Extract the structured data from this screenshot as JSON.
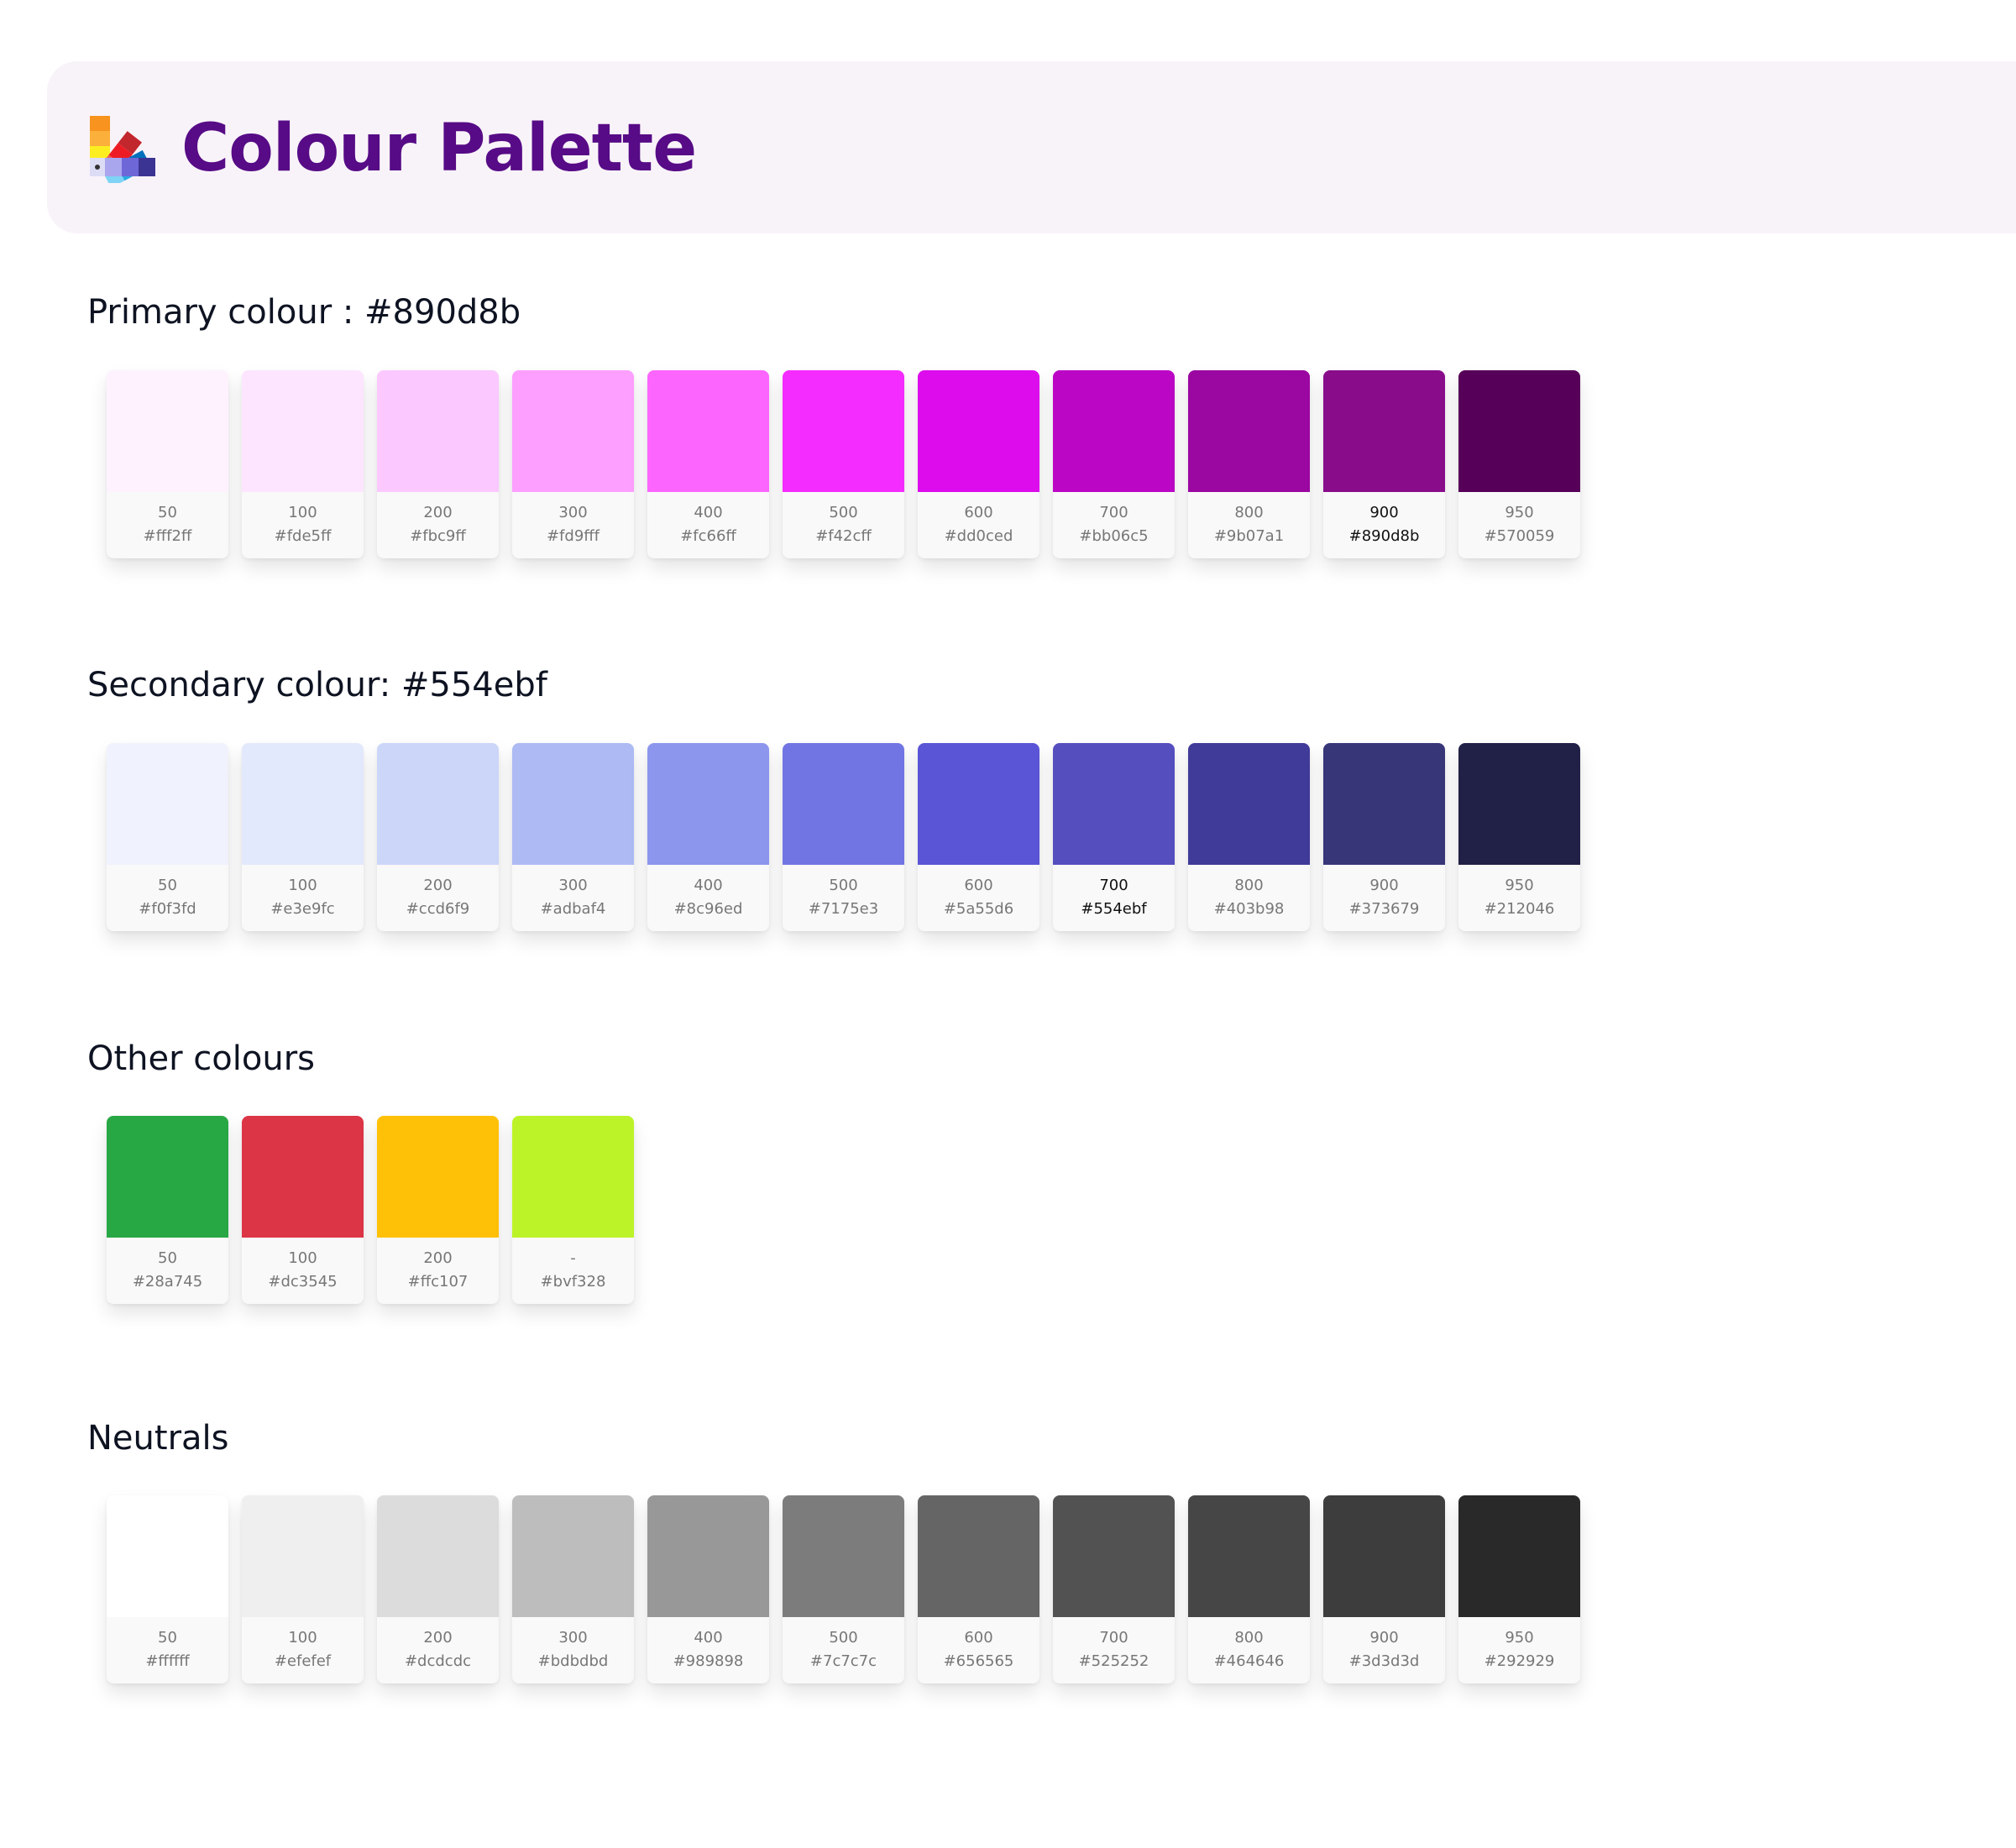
{
  "header": {
    "title": "Colour Palette",
    "icon": "colour-swatch-fan-icon"
  },
  "sections": [
    {
      "title": "Primary colour : #890d8b",
      "swatches": [
        {
          "name": "50",
          "hex": "#fff2ff",
          "color": "#fff2ff",
          "highlight": false
        },
        {
          "name": "100",
          "hex": "#fde5ff",
          "color": "#fde5ff",
          "highlight": false
        },
        {
          "name": "200",
          "hex": "#fbc9ff",
          "color": "#fbc9ff",
          "highlight": false
        },
        {
          "name": "300",
          "hex": "#fd9fff",
          "color": "#fd9fff",
          "highlight": false
        },
        {
          "name": "400",
          "hex": "#fc66ff",
          "color": "#fc66ff",
          "highlight": false
        },
        {
          "name": "500",
          "hex": "#f42cff",
          "color": "#f42cff",
          "highlight": false
        },
        {
          "name": "600",
          "hex": "#dd0ced",
          "color": "#dd0ced",
          "highlight": false
        },
        {
          "name": "700",
          "hex": "#bb06c5",
          "color": "#bb06c5",
          "highlight": false
        },
        {
          "name": "800",
          "hex": "#9b07a1",
          "color": "#9b07a1",
          "highlight": false
        },
        {
          "name": "900",
          "hex": "#890d8b",
          "color": "#890d8b",
          "highlight": true
        },
        {
          "name": "950",
          "hex": "#570059",
          "color": "#570059",
          "highlight": false
        }
      ]
    },
    {
      "title": "Secondary colour: #554ebf",
      "swatches": [
        {
          "name": "50",
          "hex": "#f0f3fd",
          "color": "#f0f3fd",
          "highlight": false
        },
        {
          "name": "100",
          "hex": "#e3e9fc",
          "color": "#e3e9fc",
          "highlight": false
        },
        {
          "name": "200",
          "hex": "#ccd6f9",
          "color": "#ccd6f9",
          "highlight": false
        },
        {
          "name": "300",
          "hex": "#adbaf4",
          "color": "#adbaf4",
          "highlight": false
        },
        {
          "name": "400",
          "hex": "#8c96ed",
          "color": "#8c96ed",
          "highlight": false
        },
        {
          "name": "500",
          "hex": "#7175e3",
          "color": "#7175e3",
          "highlight": false
        },
        {
          "name": "600",
          "hex": "#5a55d6",
          "color": "#5a55d6",
          "highlight": false
        },
        {
          "name": "700",
          "hex": "#554ebf",
          "color": "#554ebf",
          "highlight": true
        },
        {
          "name": "800",
          "hex": "#403b98",
          "color": "#403b98",
          "highlight": false
        },
        {
          "name": "900",
          "hex": "#373679",
          "color": "#373679",
          "highlight": false
        },
        {
          "name": "950",
          "hex": "#212046",
          "color": "#212046",
          "highlight": false
        }
      ]
    },
    {
      "title": "Other colours",
      "swatches": [
        {
          "name": "50",
          "hex": "#28a745",
          "color": "#28a745",
          "highlight": false
        },
        {
          "name": "100",
          "hex": "#dc3545",
          "color": "#dc3545",
          "highlight": false
        },
        {
          "name": "200",
          "hex": "#ffc107",
          "color": "#ffc107",
          "highlight": false
        },
        {
          "name": "-",
          "hex": "#bvf328",
          "color": "#bcf328",
          "highlight": false
        }
      ]
    },
    {
      "title": "Neutrals",
      "swatches": [
        {
          "name": "50",
          "hex": "#ffffff",
          "color": "#ffffff",
          "highlight": false
        },
        {
          "name": "100",
          "hex": "#efefef",
          "color": "#efefef",
          "highlight": false
        },
        {
          "name": "200",
          "hex": "#dcdcdc",
          "color": "#dcdcdc",
          "highlight": false
        },
        {
          "name": "300",
          "hex": "#bdbdbd",
          "color": "#bdbdbd",
          "highlight": false
        },
        {
          "name": "400",
          "hex": "#989898",
          "color": "#989898",
          "highlight": false
        },
        {
          "name": "500",
          "hex": "#7c7c7c",
          "color": "#7c7c7c",
          "highlight": false
        },
        {
          "name": "600",
          "hex": "#656565",
          "color": "#656565",
          "highlight": false
        },
        {
          "name": "700",
          "hex": "#525252",
          "color": "#525252",
          "highlight": false
        },
        {
          "name": "800",
          "hex": "#464646",
          "color": "#464646",
          "highlight": false
        },
        {
          "name": "900",
          "hex": "#3d3d3d",
          "color": "#3d3d3d",
          "highlight": false
        },
        {
          "name": "950",
          "hex": "#292929",
          "color": "#292929",
          "highlight": false
        }
      ]
    }
  ]
}
